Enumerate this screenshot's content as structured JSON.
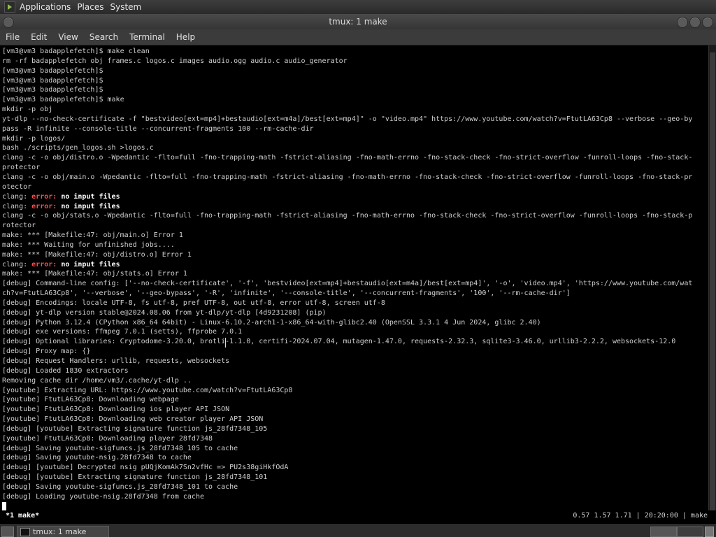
{
  "top_panel": {
    "menus": [
      "Applications",
      "Places",
      "System"
    ]
  },
  "window": {
    "title": "tmux: 1 make"
  },
  "menubar": {
    "items": [
      "File",
      "Edit",
      "View",
      "Search",
      "Terminal",
      "Help"
    ]
  },
  "terminal": {
    "lines": [
      "[vm3@vm3 badapplefetch]$ make clean",
      "rm -rf badapplefetch obj frames.c logos.c images audio.ogg audio.c audio_generator",
      "[vm3@vm3 badapplefetch]$",
      "[vm3@vm3 badapplefetch]$",
      "[vm3@vm3 badapplefetch]$",
      "[vm3@vm3 badapplefetch]$ make",
      "mkdir -p obj",
      "yt-dlp --no-check-certificate -f \"bestvideo[ext=mp4]+bestaudio[ext=m4a]/best[ext=mp4]\" -o \"video.mp4\" https://www.youtube.com/watch?v=FtutLA63Cp8 --verbose --geo-by",
      "pass -R infinite --console-title --concurrent-fragments 100 --rm-cache-dir",
      "mkdir -p logos/",
      "bash ./scripts/gen_logos.sh >logos.c",
      "clang -c -o obj/distro.o -Wpedantic -flto=full -fno-trapping-math -fstrict-aliasing -fno-math-errno -fno-stack-check -fno-strict-overflow -funroll-loops -fno-stack-",
      "protector",
      "clang -c -o obj/main.o -Wpedantic -flto=full -fno-trapping-math -fstrict-aliasing -fno-math-errno -fno-stack-check -fno-strict-overflow -funroll-loops -fno-stack-pr",
      "otector",
      "clang: |error:| |no input files|",
      "clang: |error:| |no input files|",
      "clang -c -o obj/stats.o -Wpedantic -flto=full -fno-trapping-math -fstrict-aliasing -fno-math-errno -fno-stack-check -fno-strict-overflow -funroll-loops -fno-stack-p",
      "rotector",
      "make: *** [Makefile:47: obj/main.o] Error 1",
      "make: *** Waiting for unfinished jobs....",
      "make: *** [Makefile:47: obj/distro.o] Error 1",
      "clang: |error:| |no input files|",
      "make: *** [Makefile:47: obj/stats.o] Error 1",
      "[debug] Command-line config: ['--no-check-certificate', '-f', 'bestvideo[ext=mp4]+bestaudio[ext=m4a]/best[ext=mp4]', '-o', 'video.mp4', 'https://www.youtube.com/wat",
      "ch?v=FtutLA63Cp8', '--verbose', '--geo-bypass', '-R', 'infinite', '--console-title', '--concurrent-fragments', '100', '--rm-cache-dir']",
      "[debug] Encodings: locale UTF-8, fs utf-8, pref UTF-8, out utf-8, error utf-8, screen utf-8",
      "[debug] yt-dlp version stable@2024.08.06 from yt-dlp/yt-dlp [4d9231208] (pip)",
      "[debug] Python 3.12.4 (CPython x86_64 64bit) - Linux-6.10.2-arch1-1-x86_64-with-glibc2.40 (OpenSSL 3.3.1 4 Jun 2024, glibc 2.40)",
      "[debug] exe versions: ffmpeg 7.0.1 (setts), ffprobe 7.0.1",
      "[debug] Optional libraries: Cryptodome-3.20.0, brotli-1.1.0, certifi-2024.07.04, mutagen-1.47.0, requests-2.32.3, sqlite3-3.46.0, urllib3-2.2.2, websockets-12.0",
      "[debug] Proxy map: {}",
      "[debug] Request Handlers: urllib, requests, websockets",
      "[debug] Loaded 1830 extractors",
      "Removing cache dir /home/vm3/.cache/yt-dlp ..",
      "[youtube] Extracting URL: https://www.youtube.com/watch?v=FtutLA63Cp8",
      "[youtube] FtutLA63Cp8: Downloading webpage",
      "[youtube] FtutLA63Cp8: Downloading ios player API JSON",
      "[youtube] FtutLA63Cp8: Downloading web creator player API JSON",
      "[debug] [youtube] Extracting signature function js_28fd7348_105",
      "[youtube] FtutLA63Cp8: Downloading player 28fd7348",
      "[debug] Saving youtube-sigfuncs.js_28fd7348_105 to cache",
      "[debug] Saving youtube-nsig.28fd7348 to cache",
      "[debug] [youtube] Decrypted nsig pUQjKomAk7Sn2vfHc => PU2s38giHkfOdA",
      "[debug] [youtube] Extracting signature function js_28fd7348_101",
      "[debug] Saving youtube-sigfuncs.js_28fd7348_101 to cache",
      "[debug] Loading youtube-nsig.28fd7348 from cache"
    ]
  },
  "tmux_status": {
    "left": "*1 make*",
    "right": "0.57 1.57 1.71 | 20:20:00 | make"
  },
  "taskbar": {
    "task_label": "tmux: 1 make"
  },
  "icons": {
    "app_menu": "gnome-foot-icon",
    "window_buttons": [
      "window-menu-icon",
      "minimize-icon",
      "maximize-icon",
      "close-icon"
    ],
    "taskbar": [
      "show-desktop-icon",
      "terminal-icon",
      "workspace-switcher-icon",
      "trash-icon"
    ]
  }
}
